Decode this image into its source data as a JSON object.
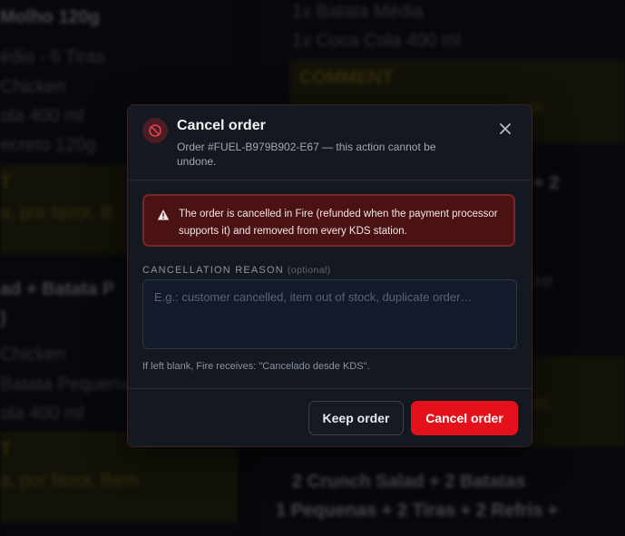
{
  "background": {
    "left_lines": [
      {
        "text": "Molho 120g",
        "style": "bold"
      },
      {
        "text": "édio - 6 Tiras",
        "style": "normal"
      },
      {
        "text": "Chicken",
        "style": "normal"
      },
      {
        "text": "ola 400 ml",
        "style": "normal"
      },
      {
        "text": "ecreto 120g",
        "style": "normal"
      },
      {
        "text": "T",
        "style": "yellow-bold"
      },
      {
        "text": "a, por favor. B",
        "style": "yellow"
      },
      {
        "text": "ad + Batata P",
        "style": "bold"
      },
      {
        "text": ")",
        "style": "bold"
      },
      {
        "text": "Chicken",
        "style": "normal"
      },
      {
        "text": "Batata Pequena",
        "style": "normal"
      },
      {
        "text": "ola 400 ml",
        "style": "normal"
      },
      {
        "text": "T",
        "style": "yellow-bold"
      },
      {
        "text": "a, por favor. Bem",
        "style": "yellow"
      }
    ],
    "right_lines": [
      {
        "text": "1x Batata Média",
        "style": "normal"
      },
      {
        "text": "1x Coca Cola 400 ml",
        "style": "normal"
      },
      {
        "text": "COMMENT",
        "style": "yellow-bold"
      },
      {
        "text": "m",
        "style": "yellow"
      },
      {
        "text": "+ 2",
        "style": "bold"
      },
      {
        "text": "xe",
        "style": "normal"
      },
      {
        "text": "m",
        "style": "yellow"
      },
      {
        "text": "2 Crunch Salad + 2 Batatas",
        "style": "bold"
      },
      {
        "text": "1  Pequenas + 2 Tiras + 2 Refris +",
        "style": "bold"
      }
    ]
  },
  "modal": {
    "title": "Cancel order",
    "subtitle": "Order #FUEL-B979B902-E67 — this action cannot be undone.",
    "header_icon": "ban-icon",
    "close_icon": "close-icon",
    "alert": {
      "icon": "warning-icon",
      "text": "The order is cancelled in Fire (refunded when the payment processor supports it) and removed from every KDS station."
    },
    "reason": {
      "label": "CANCELLATION REASON",
      "optional": "(optional)",
      "value": "",
      "placeholder": "E.g.: customer cancelled, item out of stock, duplicate order…",
      "help": "If left blank, Fire receives: \"Cancelado desde KDS\"."
    },
    "buttons": {
      "keep": "Keep order",
      "cancel": "Cancel order"
    }
  },
  "colors": {
    "danger": "#e3111b",
    "alert_bg": "#4a1212",
    "alert_border": "#7a2528",
    "modal_bg": "#141821"
  }
}
